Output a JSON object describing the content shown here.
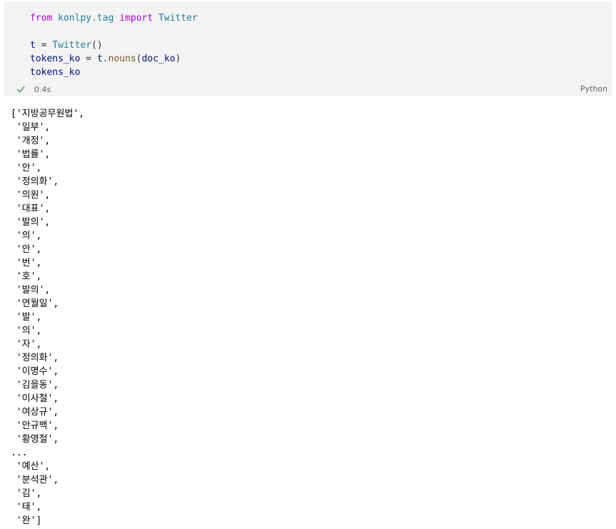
{
  "cell": {
    "code": {
      "line1": {
        "kw_from": "from",
        "module": "konlpy.tag",
        "kw_import": "import",
        "name": "Twitter"
      },
      "line2": "",
      "line3": {
        "var": "t",
        "op": " = ",
        "cls": "Twitter",
        "parens": "()"
      },
      "line4": {
        "var": "tokens_ko",
        "op": " = ",
        "obj": "t",
        "dot": ".",
        "method": "nouns",
        "open": "(",
        "arg": "doc_ko",
        "close": ")"
      },
      "line5": {
        "var": "tokens_ko"
      }
    },
    "status": {
      "icon": "check-icon",
      "time": "0.4s",
      "success_color": "#388a34"
    },
    "language": "Python"
  },
  "output": {
    "lines": [
      "['지방공무원법',",
      " '일부',",
      " '개정',",
      " '법률',",
      " '안',",
      " '정의화',",
      " '의원',",
      " '대표',",
      " '발의',",
      " '의',",
      " '안',",
      " '번',",
      " '호',",
      " '발의',",
      " '연월일',",
      " '발',",
      " '의',",
      " '자',",
      " '정의화',",
      " '이명수',",
      " '김을동',",
      " '이사철',",
      " '여상규',",
      " '안규백',",
      " '황영철',",
      "...",
      " '예산',",
      " '분석관',",
      " '김',",
      " '태',",
      " '완']"
    ]
  }
}
